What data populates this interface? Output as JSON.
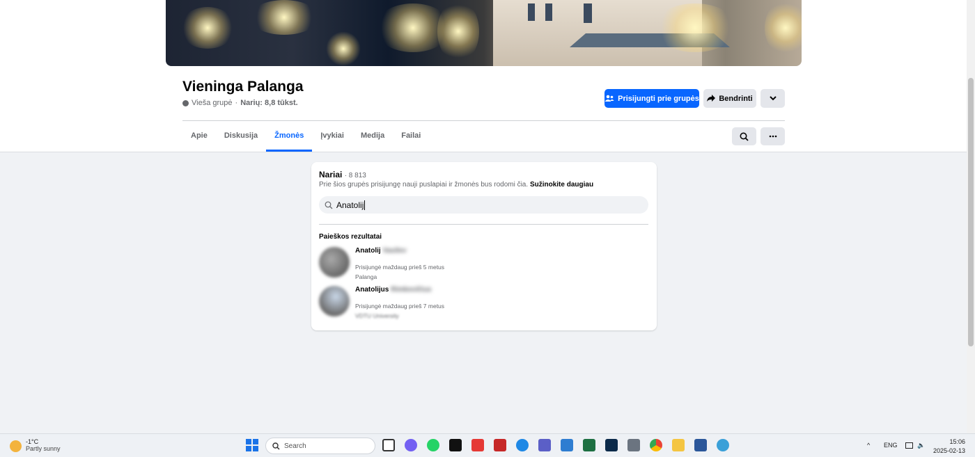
{
  "group": {
    "name": "Vieninga Palanga",
    "privacy": "Vieša grupė",
    "members_summary": "Narių: 8,8 tūkst.",
    "join_label": "Prisijungti prie grupės",
    "share_label": "Bendrinti"
  },
  "tabs": [
    "Apie",
    "Diskusija",
    "Žmonės",
    "Įvykiai",
    "Medija",
    "Failai"
  ],
  "active_tab": "Žmonės",
  "members": {
    "title": "Nariai",
    "count": "· 8 813",
    "description": "Prie šios grupės prisijungę nauji puslapiai ir žmonės bus rodomi čia.",
    "learn_more": "Sužinokite daugiau",
    "search_value": "Anatolij",
    "results_title": "Paieškos rezultatai",
    "results": [
      {
        "name": "Anatolij",
        "name_hidden": "Vasilev",
        "joined": "Prisijungė maždaug prieš 5 metus",
        "detail": "Palanga"
      },
      {
        "name": "Anatolijus",
        "name_hidden": "Rimkevičius",
        "joined": "Prisijungė maždaug prieš 7 metus",
        "detail": "VDTU University"
      }
    ]
  },
  "taskbar": {
    "temperature": "-1°C",
    "weather": "Partly sunny",
    "search_label": "Search",
    "language": "ENG",
    "time": "15:06",
    "date": "2025-02-13"
  },
  "colors": {
    "accent": "#0866ff",
    "background": "#f0f2f5"
  }
}
